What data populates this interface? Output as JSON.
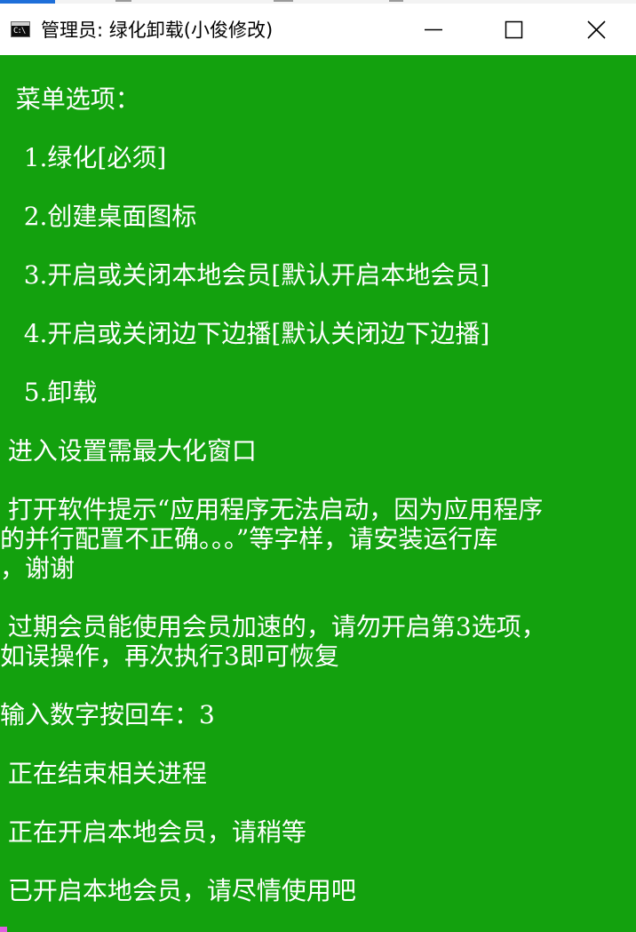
{
  "window": {
    "title": "管理员:  绿化卸载(小俊修改)",
    "icon": "cmd-icon",
    "icon_prompt": "C:\\",
    "controls": {
      "minimize": "minimize-icon",
      "maximize": "maximize-icon",
      "close": "close-icon"
    }
  },
  "colors": {
    "console_background": "#13a10e",
    "console_text": "#ffffff",
    "titlebar": "#ffffff"
  },
  "console": {
    "lines": [
      "  菜单选项：",
      "   1.绿化[必须]",
      "   2.创建桌面图标",
      "   3.开启或关闭本地会员[默认开启本地会员]",
      "   4.开启或关闭边下边播[默认关闭边下边播]",
      "   5.卸载",
      " 进入设置需最大化窗口",
      " 打开软件提示“应用程序无法启动，因为应用程序",
      "的并行配置不正确。。。”等字样，请安装运行库",
      "，谢谢",
      " 过期会员能使用会员加速的，请勿开启第3选项，",
      "如误操作，再次执行3即可恢复",
      "输入数字按回车：3",
      " 正在结束相关进程",
      " 正在开启本地会员，请稍等",
      " 已开启本地会员，请尽情使用吧"
    ]
  }
}
